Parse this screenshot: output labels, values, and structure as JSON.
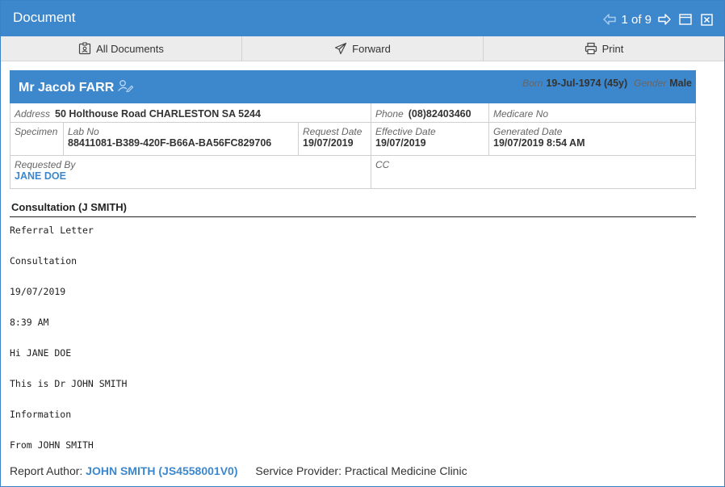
{
  "window": {
    "title": "Document"
  },
  "pager": {
    "text": "1 of 9"
  },
  "toolbar": {
    "all_documents": "All Documents",
    "forward": "Forward",
    "print": "Print"
  },
  "patient": {
    "name": "Mr Jacob FARR",
    "born_label": "Born",
    "born_value": "19-Jul-1974 (45y)",
    "gender_label": "Gender",
    "gender_value": "Male"
  },
  "details": {
    "address_label": "Address",
    "address_value": "50 Holthouse Road CHARLESTON SA 5244",
    "phone_label": "Phone",
    "phone_value": "(08)82403460",
    "medicare_label": "Medicare No",
    "medicare_value": "",
    "specimen_label": "Specimen",
    "labno_label": "Lab No",
    "labno_value": "88411081-B389-420F-B66A-BA56FC829706",
    "request_date_label": "Request Date",
    "request_date_value": "19/07/2019",
    "effective_date_label": "Effective Date",
    "effective_date_value": "19/07/2019",
    "generated_date_label": "Generated Date",
    "generated_date_value": "19/07/2019 8:54 AM",
    "requested_by_label": "Requested By",
    "requested_by_value": "JANE DOE",
    "cc_label": "CC",
    "cc_value": ""
  },
  "section": {
    "title": "Consultation (J SMITH)"
  },
  "body_lines": [
    "Referral Letter",
    "Consultation",
    "19/07/2019",
    "8:39 AM",
    "Hi JANE DOE",
    "This is Dr JOHN SMITH",
    "Information",
    "From JOHN SMITH"
  ],
  "footer": {
    "author_label": "Report Author:",
    "author_value": "JOHN SMITH (JS4558001V0)",
    "provider_label": "Service Provider:",
    "provider_value": "Practical Medicine Clinic"
  },
  "colors": {
    "accent": "#3d87cc",
    "toolbar": "#ececec"
  },
  "icons": [
    "arrow-left-icon",
    "arrow-right-icon",
    "maximize-icon",
    "close-icon",
    "id-badge-icon",
    "paper-plane-icon",
    "printer-icon",
    "user-edit-icon"
  ]
}
